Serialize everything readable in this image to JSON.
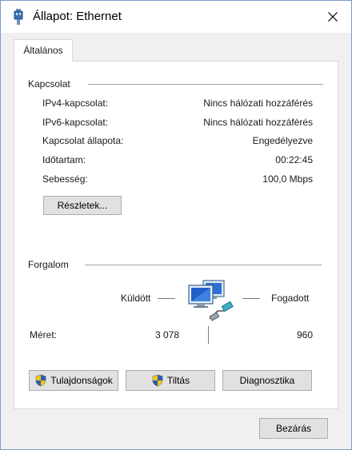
{
  "window": {
    "title": "Állapot: Ethernet"
  },
  "tab": {
    "label": "Általános"
  },
  "connection": {
    "heading": "Kapcsolat",
    "rows": [
      {
        "label": "IPv4-kapcsolat:",
        "value": "Nincs hálózati hozzáférés"
      },
      {
        "label": "IPv6-kapcsolat:",
        "value": "Nincs hálózati hozzáférés"
      },
      {
        "label": "Kapcsolat állapota:",
        "value": "Engedélyezve"
      },
      {
        "label": "Időtartam:",
        "value": "00:22:45"
      },
      {
        "label": "Sebesség:",
        "value": "100,0 Mbps"
      }
    ],
    "details_button": "Részletek..."
  },
  "traffic": {
    "heading": "Forgalom",
    "sent_label": "Küldött",
    "received_label": "Fogadott",
    "size_label": "Méret:",
    "sent_value": "3 078",
    "received_value": "960"
  },
  "actions": {
    "properties_button": "Tulajdonságok",
    "disable_button": "Tiltás",
    "diagnose_button": "Diagnosztika"
  },
  "footer": {
    "close_button": "Bezárás"
  },
  "colors": {
    "window_border": "#7a9cc6",
    "dialog_background": "#f0f0f0",
    "panel_background": "#ffffff",
    "button_face": "#e1e1e1",
    "shield_blue": "#2b5fb4",
    "shield_yellow": "#f2c318"
  },
  "icons": {
    "title": "network-adapter-icon",
    "close": "close-icon",
    "activity": "network-activity-icon",
    "shield": "uac-shield-icon"
  }
}
